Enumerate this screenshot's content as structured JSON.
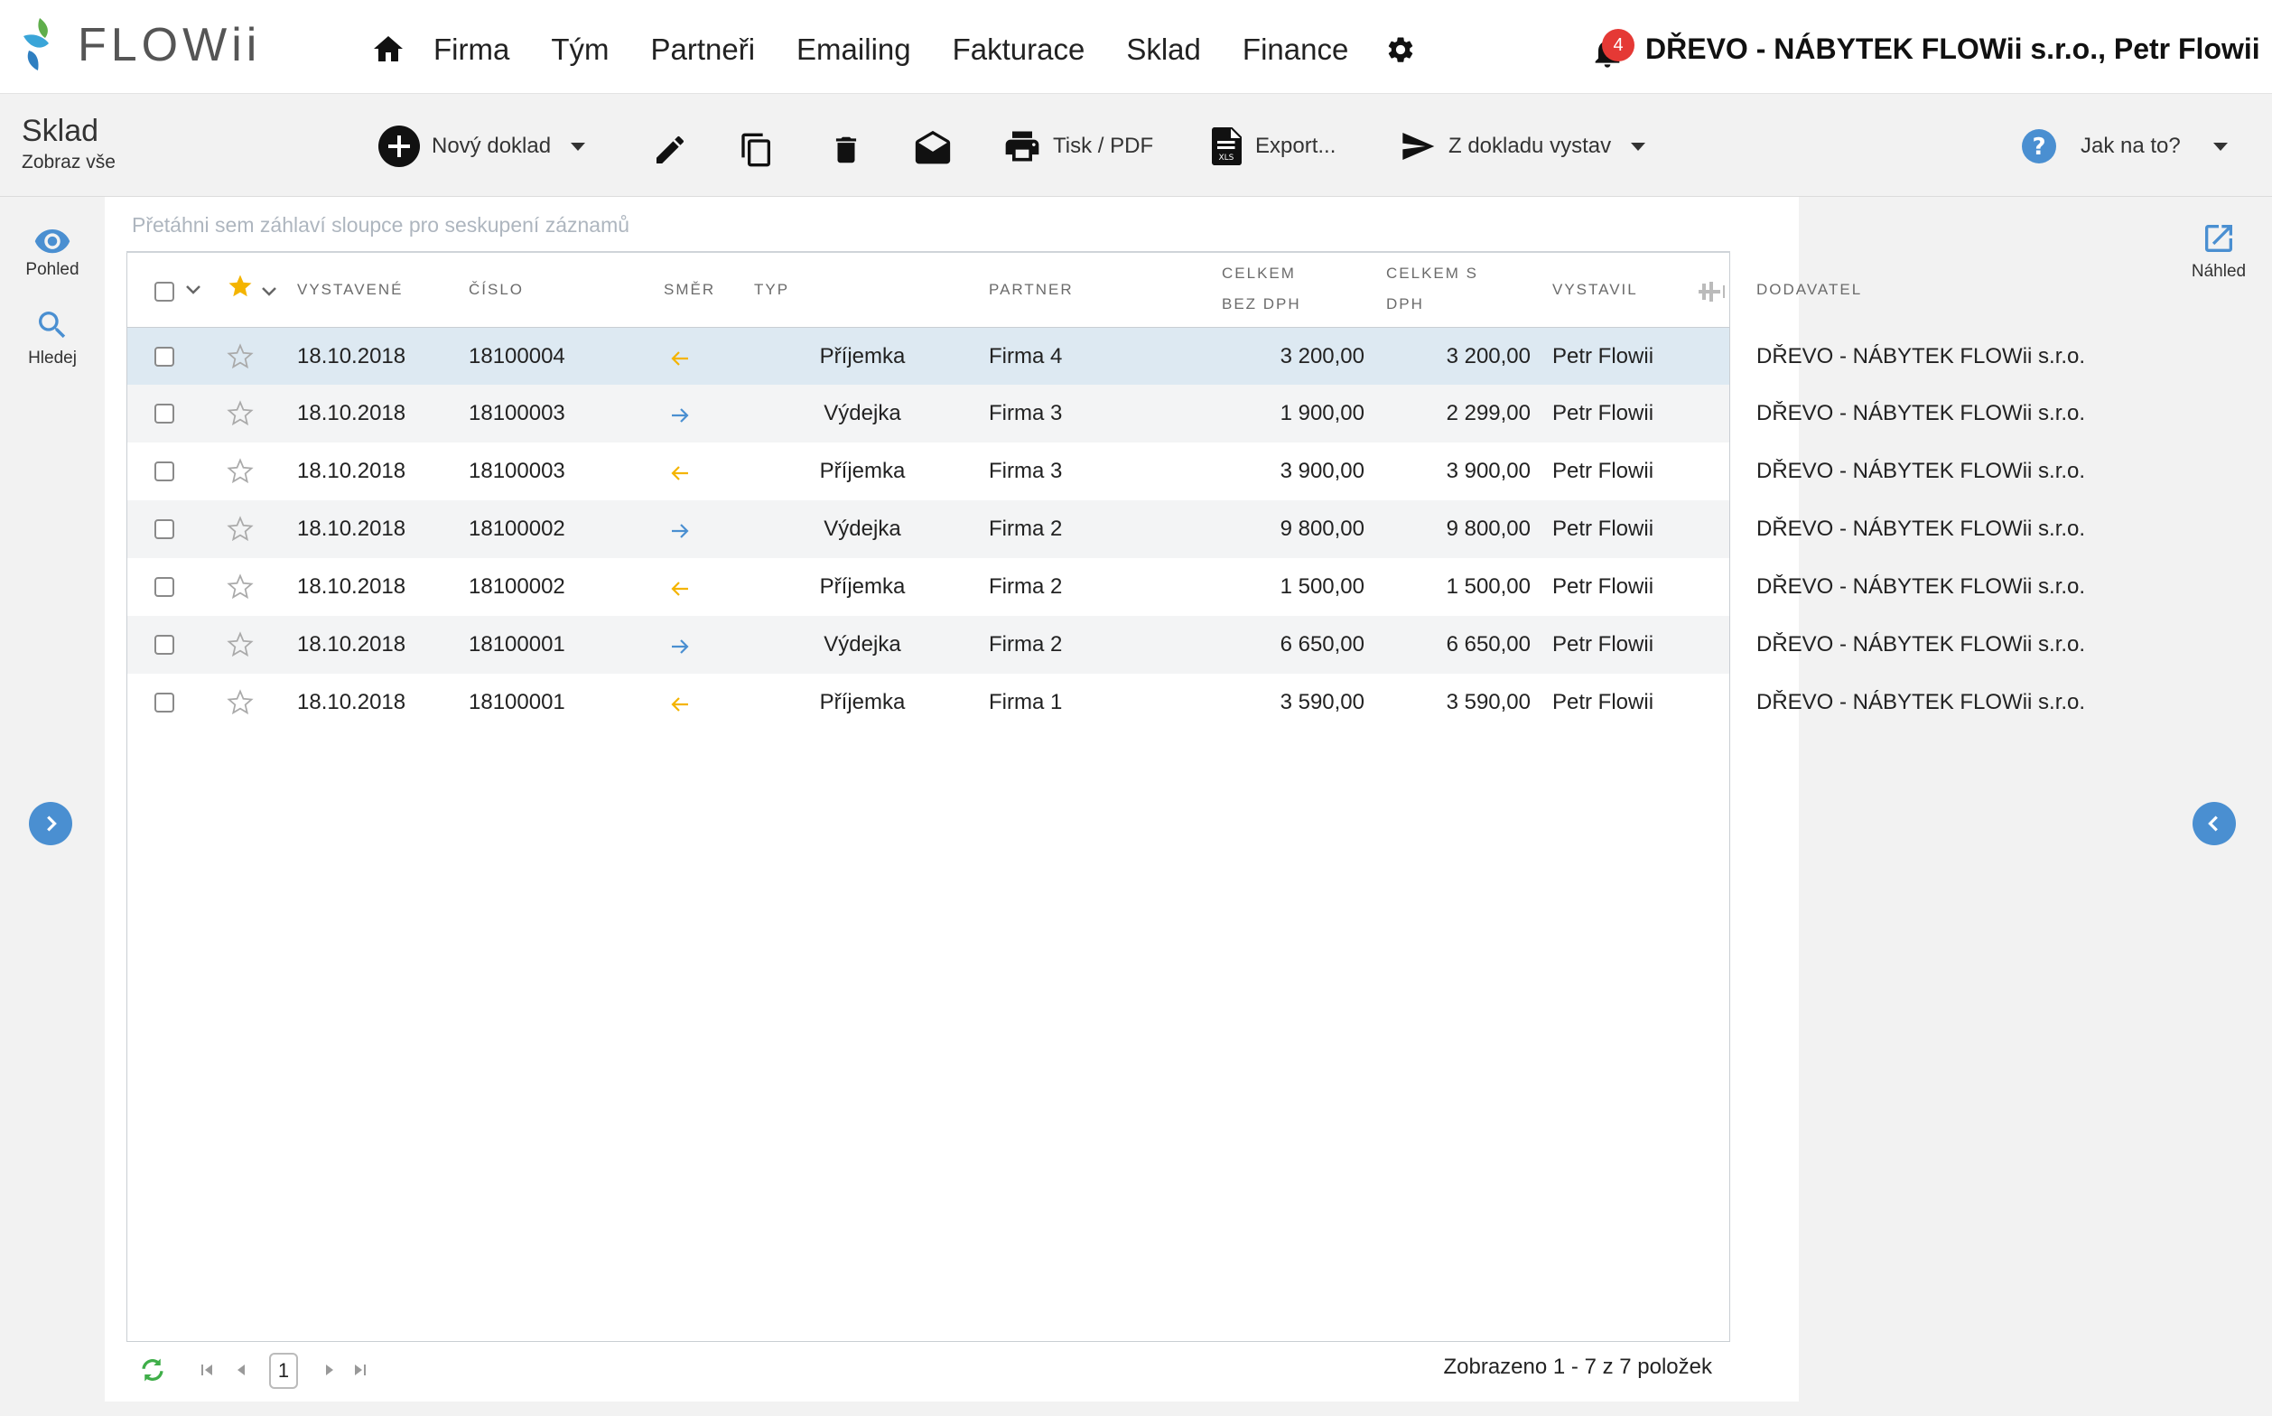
{
  "app": {
    "logo_text": "FLOWii",
    "nav": [
      "Firma",
      "Tým",
      "Partneři",
      "Emailing",
      "Fakturace",
      "Sklad",
      "Finance"
    ],
    "notifications_count": "4",
    "company_user": "DŘEVO - NÁBYTEK FLOWii s.r.o., Petr Flowii"
  },
  "page": {
    "title": "Sklad",
    "subtitle": "Zobraz vše"
  },
  "toolbar": {
    "new_doc": "Nový doklad",
    "print": "Tisk / PDF",
    "export": "Export...",
    "issue_from": "Z dokladu vystav",
    "help": "Jak na to?"
  },
  "left_rail": {
    "view": "Pohled",
    "search": "Hledej"
  },
  "right_rail": {
    "preview": "Náhled"
  },
  "grid": {
    "group_hint": "Přetáhni sem záhlaví sloupce pro seskupení záznamů",
    "columns": {
      "issued": "VYSTAVENÉ",
      "number": "ČÍSLO",
      "direction": "SMĚR",
      "type": "TYP",
      "partner": "PARTNER",
      "total_net_1": "CELKEM",
      "total_net_2": "BEZ DPH",
      "total_gross_1": "CELKEM S",
      "total_gross_2": "DPH",
      "issued_by": "VYSTAVIL",
      "supplier": "DODAVATEL"
    },
    "rows": [
      {
        "issued": "18.10.2018",
        "number": "18100004",
        "direction": "in",
        "type": "Příjemka",
        "partner": "Firma 4",
        "net": "3 200,00",
        "gross": "3 200,00",
        "issued_by": "Petr Flowii",
        "supplier": "DŘEVO - NÁBYTEK FLOWii s.r.o."
      },
      {
        "issued": "18.10.2018",
        "number": "18100003",
        "direction": "out",
        "type": "Výdejka",
        "partner": "Firma 3",
        "net": "1 900,00",
        "gross": "2 299,00",
        "issued_by": "Petr Flowii",
        "supplier": "DŘEVO - NÁBYTEK FLOWii s.r.o."
      },
      {
        "issued": "18.10.2018",
        "number": "18100003",
        "direction": "in",
        "type": "Příjemka",
        "partner": "Firma 3",
        "net": "3 900,00",
        "gross": "3 900,00",
        "issued_by": "Petr Flowii",
        "supplier": "DŘEVO - NÁBYTEK FLOWii s.r.o."
      },
      {
        "issued": "18.10.2018",
        "number": "18100002",
        "direction": "out",
        "type": "Výdejka",
        "partner": "Firma 2",
        "net": "9 800,00",
        "gross": "9 800,00",
        "issued_by": "Petr Flowii",
        "supplier": "DŘEVO - NÁBYTEK FLOWii s.r.o."
      },
      {
        "issued": "18.10.2018",
        "number": "18100002",
        "direction": "in",
        "type": "Příjemka",
        "partner": "Firma 2",
        "net": "1 500,00",
        "gross": "1 500,00",
        "issued_by": "Petr Flowii",
        "supplier": "DŘEVO - NÁBYTEK FLOWii s.r.o."
      },
      {
        "issued": "18.10.2018",
        "number": "18100001",
        "direction": "out",
        "type": "Výdejka",
        "partner": "Firma 2",
        "net": "6 650,00",
        "gross": "6 650,00",
        "issued_by": "Petr Flowii",
        "supplier": "DŘEVO - NÁBYTEK FLOWii s.r.o."
      },
      {
        "issued": "18.10.2018",
        "number": "18100001",
        "direction": "in",
        "type": "Příjemka",
        "partner": "Firma 1",
        "net": "3 590,00",
        "gross": "3 590,00",
        "issued_by": "Petr Flowii",
        "supplier": "DŘEVO - NÁBYTEK FLOWii s.r.o."
      }
    ],
    "selected_row": 0
  },
  "pager": {
    "page": "1",
    "summary": "Zobrazeno 1 - 7 z 7 položek"
  },
  "colors": {
    "accent_blue": "#4a8fd1",
    "in_arrow": "#f4b400",
    "out_arrow": "#4a8fd1",
    "star": "#f4b400",
    "badge": "#e53935"
  }
}
